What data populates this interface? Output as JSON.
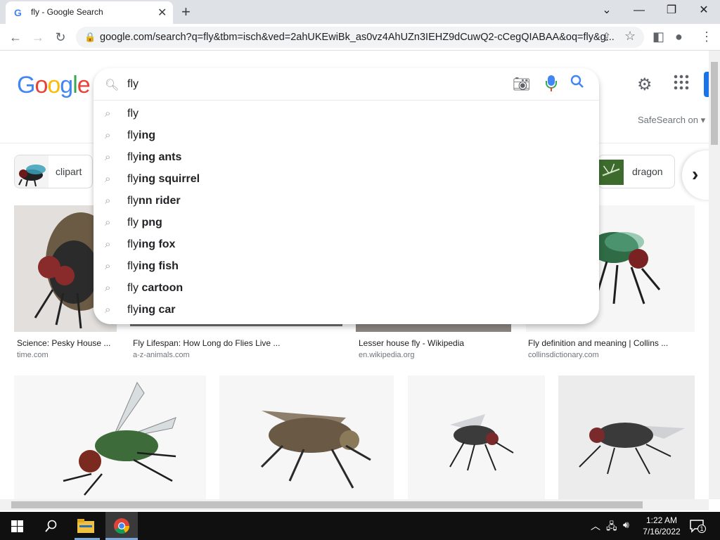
{
  "browser": {
    "tab_title": "fly - Google Search",
    "url": "google.com/search?q=fly&tbm=isch&ved=2ahUKEwiBk_as0vz4AhUZn3IEHZ9dCuwQ2-cCegQIABAA&oq=fly&g..."
  },
  "google": {
    "logo_letters": [
      "G",
      "o",
      "o",
      "g",
      "l",
      "e"
    ],
    "safesearch": "SafeSearch on ▾"
  },
  "search": {
    "query": "fly",
    "suggestions": [
      {
        "prefix": "fly",
        "bold": ""
      },
      {
        "prefix": "fly",
        "bold": "ing"
      },
      {
        "prefix": "fly",
        "bold": "ing ants"
      },
      {
        "prefix": "fly",
        "bold": "ing squirrel"
      },
      {
        "prefix": "fly",
        "bold": "nn rider"
      },
      {
        "prefix": "fly ",
        "bold": "png"
      },
      {
        "prefix": "fly",
        "bold": "ing fox"
      },
      {
        "prefix": "fly",
        "bold": "ing fish"
      },
      {
        "prefix": "fly ",
        "bold": "cartoon"
      },
      {
        "prefix": "fly",
        "bold": "ing car"
      }
    ]
  },
  "chips": [
    {
      "label": "clipart"
    },
    {
      "label": "dragon"
    }
  ],
  "results_row1": [
    {
      "caption": "Science: Pesky House ...",
      "source": "time.com"
    },
    {
      "caption": "Fly Lifespan: How Long do Flies Live ...",
      "source": "a-z-animals.com"
    },
    {
      "caption": "Lesser house fly - Wikipedia",
      "source": "en.wikipedia.org"
    },
    {
      "caption": "Fly definition and meaning | Collins ...",
      "source": "collinsdictionary.com"
    }
  ],
  "taskbar": {
    "time": "1:22 AM",
    "date": "7/16/2022",
    "notification_count": "1"
  }
}
